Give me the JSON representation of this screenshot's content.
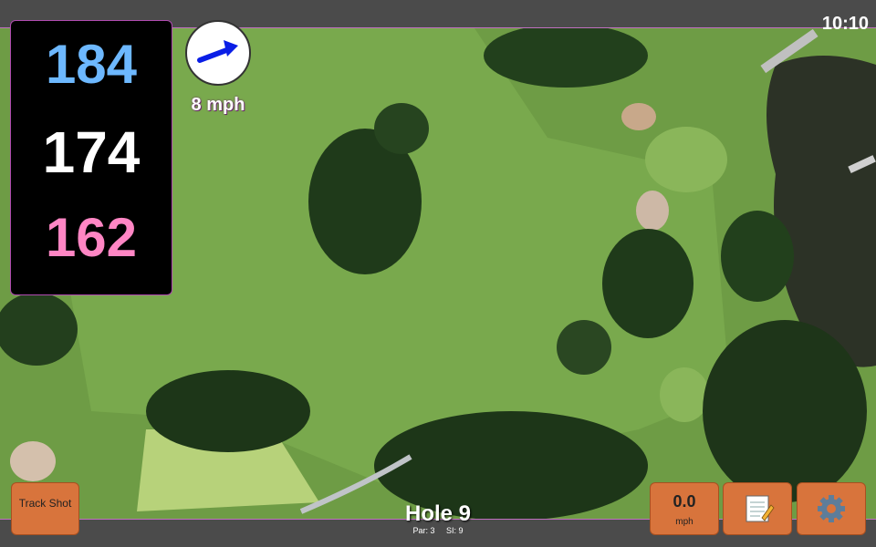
{
  "clock": "10:10",
  "distances": {
    "back": "184",
    "middle": "174",
    "front": "162"
  },
  "wind": {
    "speed_label": "8 mph",
    "direction_icon": "arrow-right-up-icon"
  },
  "hole": {
    "title": "Hole 9",
    "par": "Par: 3",
    "si": "SI: 9"
  },
  "buttons": {
    "track_shot": "Track Shot",
    "speed_value": "0.0",
    "speed_unit": "mph",
    "notes_icon": "notepad-icon",
    "settings_icon": "gear-icon"
  },
  "colors": {
    "back": "#6db8ff",
    "middle": "#ffffff",
    "front": "#ff86c4",
    "button": "#d8743c"
  }
}
